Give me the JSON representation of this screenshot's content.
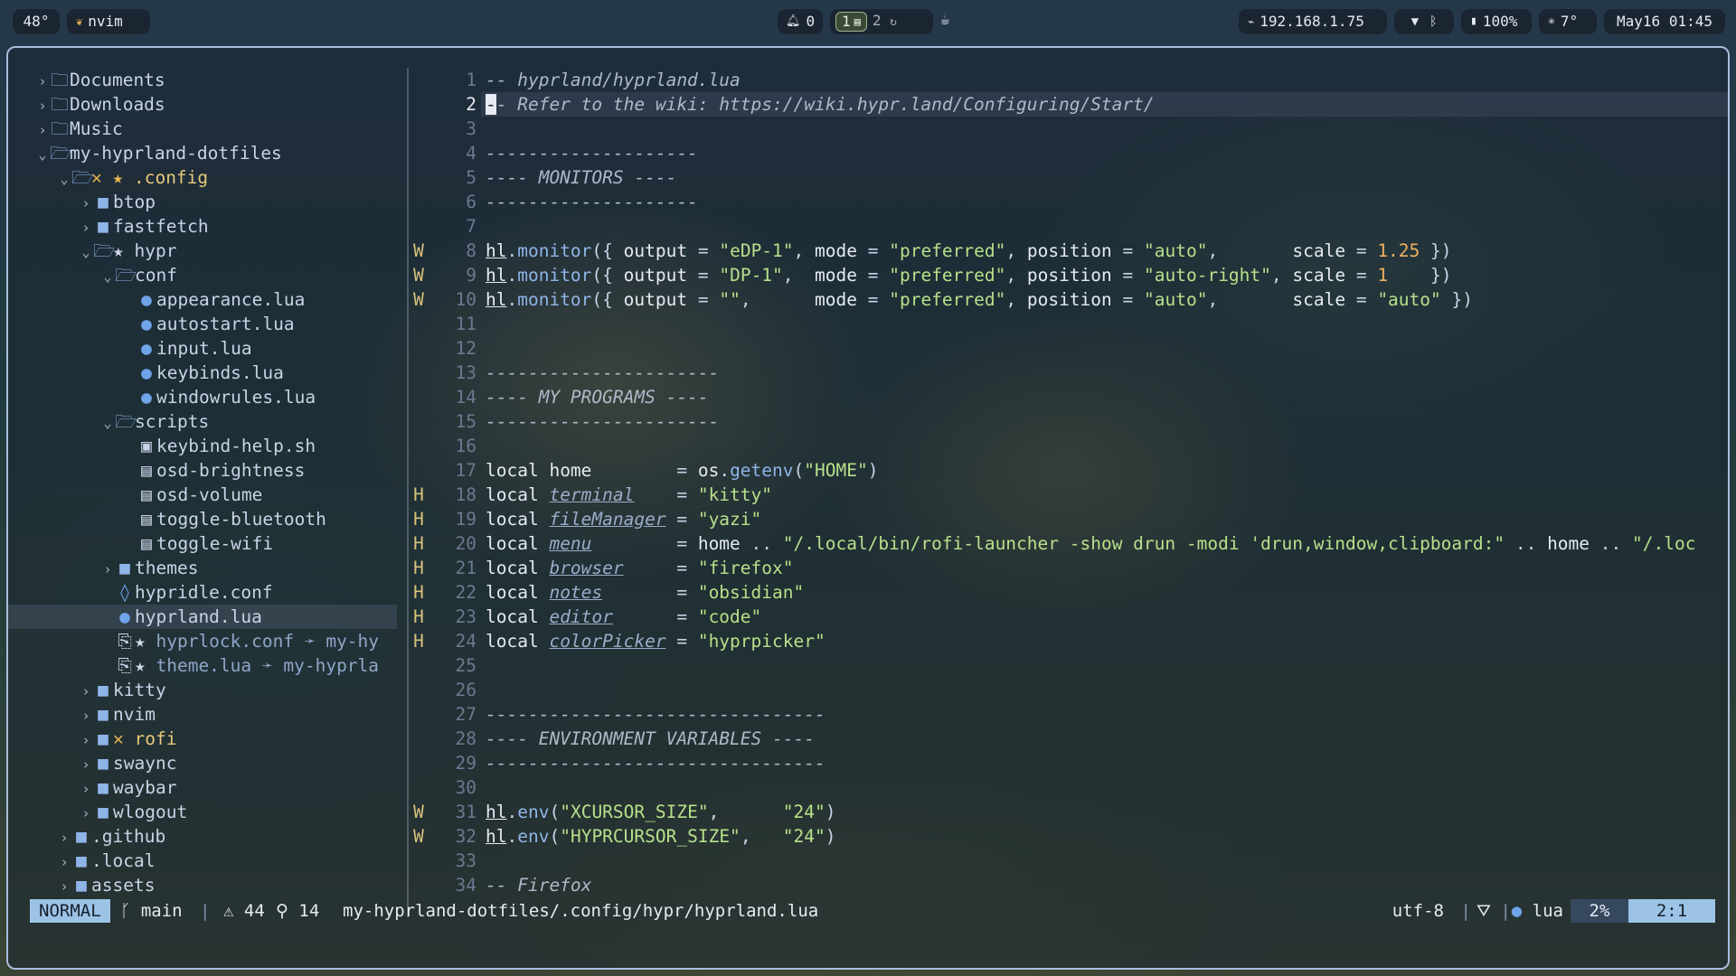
{
  "topbar": {
    "temp_left": "48°",
    "app_name": "nvim",
    "notifications": "0",
    "workspaces": [
      "1",
      "2"
    ],
    "ip": "192.168.1.75",
    "battery": "100%",
    "weather": "7°",
    "datetime": "May16 01:45"
  },
  "tree": [
    {
      "indent": 0,
      "chev": "›",
      "icon": "folder",
      "label": "Documents"
    },
    {
      "indent": 0,
      "chev": "›",
      "icon": "folder",
      "label": "Downloads"
    },
    {
      "indent": 0,
      "chev": "›",
      "icon": "folder",
      "label": "Music"
    },
    {
      "indent": 0,
      "chev": "⌄",
      "icon": "folder-open",
      "label": "my-hyprland-dotfiles"
    },
    {
      "indent": 1,
      "chev": "⌄",
      "icon": "folder-open",
      "marks": "✕ ★",
      "label": ".config",
      "labelClass": "modified"
    },
    {
      "indent": 2,
      "chev": "›",
      "icon": "folder-solid",
      "label": "btop"
    },
    {
      "indent": 2,
      "chev": "›",
      "icon": "folder-solid",
      "label": "fastfetch"
    },
    {
      "indent": 2,
      "chev": "⌄",
      "icon": "folder-open",
      "marks": "★",
      "label": "hypr"
    },
    {
      "indent": 3,
      "chev": "⌄",
      "icon": "folder-open",
      "label": "conf"
    },
    {
      "indent": 4,
      "chev": "",
      "icon": "lua",
      "label": "appearance.lua"
    },
    {
      "indent": 4,
      "chev": "",
      "icon": "lua",
      "label": "autostart.lua"
    },
    {
      "indent": 4,
      "chev": "",
      "icon": "lua",
      "label": "input.lua"
    },
    {
      "indent": 4,
      "chev": "",
      "icon": "lua",
      "label": "keybinds.lua"
    },
    {
      "indent": 4,
      "chev": "",
      "icon": "lua",
      "label": "windowrules.lua"
    },
    {
      "indent": 3,
      "chev": "⌄",
      "icon": "folder-open",
      "label": "scripts"
    },
    {
      "indent": 4,
      "chev": "",
      "icon": "shell",
      "label": "keybind-help.sh"
    },
    {
      "indent": 4,
      "chev": "",
      "icon": "file",
      "label": "osd-brightness"
    },
    {
      "indent": 4,
      "chev": "",
      "icon": "file",
      "label": "osd-volume"
    },
    {
      "indent": 4,
      "chev": "",
      "icon": "file",
      "label": "toggle-bluetooth"
    },
    {
      "indent": 4,
      "chev": "",
      "icon": "file",
      "label": "toggle-wifi"
    },
    {
      "indent": 3,
      "chev": "›",
      "icon": "folder-solid",
      "label": "themes"
    },
    {
      "indent": 3,
      "chev": "",
      "icon": "drop",
      "label": "hypridle.conf"
    },
    {
      "indent": 3,
      "chev": "",
      "icon": "lua",
      "label": "hyprland.lua",
      "selected": true
    },
    {
      "indent": 3,
      "chev": "",
      "icon": "symlink",
      "marks": "★",
      "label": "hyprlock.conf ➛ my-hy",
      "labelClass": "link-t"
    },
    {
      "indent": 3,
      "chev": "",
      "icon": "symlink",
      "marks": "★",
      "label": "theme.lua ➛ my-hyprla",
      "labelClass": "link-t"
    },
    {
      "indent": 2,
      "chev": "›",
      "icon": "folder-solid",
      "label": "kitty"
    },
    {
      "indent": 2,
      "chev": "›",
      "icon": "folder-solid",
      "label": "nvim"
    },
    {
      "indent": 2,
      "chev": "›",
      "icon": "folder-solid",
      "marks": "✕",
      "label": "rofi",
      "labelClass": "modified"
    },
    {
      "indent": 2,
      "chev": "›",
      "icon": "folder-solid",
      "label": "swaync"
    },
    {
      "indent": 2,
      "chev": "›",
      "icon": "folder-solid",
      "label": "waybar"
    },
    {
      "indent": 2,
      "chev": "›",
      "icon": "folder-solid",
      "label": "wlogout"
    },
    {
      "indent": 1,
      "chev": "›",
      "icon": "folder-solid",
      "label": ".github"
    },
    {
      "indent": 1,
      "chev": "›",
      "icon": "folder-solid",
      "label": ".local"
    },
    {
      "indent": 1,
      "chev": "›",
      "icon": "folder-solid",
      "label": "assets"
    }
  ],
  "code": [
    {
      "n": "1",
      "sign": "",
      "tokens": [
        [
          "c-cm",
          "-- hyprland/hyprland.lua"
        ]
      ]
    },
    {
      "n": "2",
      "sign": "",
      "current": true,
      "tokens": [
        [
          "cursor",
          "-"
        ],
        [
          "c-cm",
          "- Refer to the wiki: https://wiki.hypr.land/Configuring/Start/"
        ]
      ]
    },
    {
      "n": "3",
      "sign": "",
      "tokens": []
    },
    {
      "n": "4",
      "sign": "",
      "tokens": [
        [
          "c-cm",
          "--------------------"
        ]
      ]
    },
    {
      "n": "5",
      "sign": "",
      "tokens": [
        [
          "c-cm",
          "---- MONITORS ----"
        ]
      ]
    },
    {
      "n": "6",
      "sign": "",
      "tokens": [
        [
          "c-cm",
          "--------------------"
        ]
      ]
    },
    {
      "n": "7",
      "sign": "",
      "tokens": []
    },
    {
      "n": "8",
      "sign": "W",
      "tokens": [
        [
          "c-ul",
          "hl"
        ],
        [
          "c-p",
          "."
        ],
        [
          "c-fn",
          "monitor"
        ],
        [
          "c-p",
          "({ "
        ],
        [
          "c-id",
          "output"
        ],
        [
          "c-p",
          " = "
        ],
        [
          "c-str",
          "\"eDP-1\""
        ],
        [
          "c-p",
          ", "
        ],
        [
          "c-id",
          "mode"
        ],
        [
          "c-p",
          " = "
        ],
        [
          "c-str",
          "\"preferred\""
        ],
        [
          "c-p",
          ", "
        ],
        [
          "c-id",
          "position"
        ],
        [
          "c-p",
          " = "
        ],
        [
          "c-str",
          "\"auto\""
        ],
        [
          "c-p",
          ",       "
        ],
        [
          "c-id",
          "scale"
        ],
        [
          "c-p",
          " = "
        ],
        [
          "c-num",
          "1.25"
        ],
        [
          "c-p",
          " })"
        ]
      ]
    },
    {
      "n": "9",
      "sign": "W",
      "tokens": [
        [
          "c-ul",
          "hl"
        ],
        [
          "c-p",
          "."
        ],
        [
          "c-fn",
          "monitor"
        ],
        [
          "c-p",
          "({ "
        ],
        [
          "c-id",
          "output"
        ],
        [
          "c-p",
          " = "
        ],
        [
          "c-str",
          "\"DP-1\""
        ],
        [
          "c-p",
          ",  "
        ],
        [
          "c-id",
          "mode"
        ],
        [
          "c-p",
          " = "
        ],
        [
          "c-str",
          "\"preferred\""
        ],
        [
          "c-p",
          ", "
        ],
        [
          "c-id",
          "position"
        ],
        [
          "c-p",
          " = "
        ],
        [
          "c-str",
          "\"auto-right\""
        ],
        [
          "c-p",
          ", "
        ],
        [
          "c-id",
          "scale"
        ],
        [
          "c-p",
          " = "
        ],
        [
          "c-num",
          "1"
        ],
        [
          "c-p",
          "    })"
        ]
      ]
    },
    {
      "n": "10",
      "sign": "W",
      "tokens": [
        [
          "c-ul",
          "hl"
        ],
        [
          "c-p",
          "."
        ],
        [
          "c-fn",
          "monitor"
        ],
        [
          "c-p",
          "({ "
        ],
        [
          "c-id",
          "output"
        ],
        [
          "c-p",
          " = "
        ],
        [
          "c-str",
          "\"\""
        ],
        [
          "c-p",
          ",      "
        ],
        [
          "c-id",
          "mode"
        ],
        [
          "c-p",
          " = "
        ],
        [
          "c-str",
          "\"preferred\""
        ],
        [
          "c-p",
          ", "
        ],
        [
          "c-id",
          "position"
        ],
        [
          "c-p",
          " = "
        ],
        [
          "c-str",
          "\"auto\""
        ],
        [
          "c-p",
          ",       "
        ],
        [
          "c-id",
          "scale"
        ],
        [
          "c-p",
          " = "
        ],
        [
          "c-str",
          "\"auto\""
        ],
        [
          "c-p",
          " })"
        ]
      ]
    },
    {
      "n": "11",
      "sign": "",
      "tokens": []
    },
    {
      "n": "12",
      "sign": "",
      "tokens": []
    },
    {
      "n": "13",
      "sign": "",
      "tokens": [
        [
          "c-cm",
          "----------------------"
        ]
      ]
    },
    {
      "n": "14",
      "sign": "",
      "tokens": [
        [
          "c-cm",
          "---- MY PROGRAMS ----"
        ]
      ]
    },
    {
      "n": "15",
      "sign": "",
      "tokens": [
        [
          "c-cm",
          "----------------------"
        ]
      ]
    },
    {
      "n": "16",
      "sign": "",
      "tokens": []
    },
    {
      "n": "17",
      "sign": "",
      "tokens": [
        [
          "c-kw",
          "local "
        ],
        [
          "c-id",
          "home"
        ],
        [
          "c-p",
          "        = "
        ],
        [
          "c-id",
          "os"
        ],
        [
          "c-p",
          "."
        ],
        [
          "c-fn",
          "getenv"
        ],
        [
          "c-p",
          "("
        ],
        [
          "c-str",
          "\"HOME\""
        ],
        [
          "c-p",
          ")"
        ]
      ]
    },
    {
      "n": "18",
      "sign": "H",
      "tokens": [
        [
          "c-kw",
          "local "
        ],
        [
          "c-ulv",
          "terminal"
        ],
        [
          "c-p",
          "    = "
        ],
        [
          "c-str",
          "\"kitty\""
        ]
      ]
    },
    {
      "n": "19",
      "sign": "H",
      "tokens": [
        [
          "c-kw",
          "local "
        ],
        [
          "c-ulv",
          "fileManager"
        ],
        [
          "c-p",
          " = "
        ],
        [
          "c-str",
          "\"yazi\""
        ]
      ]
    },
    {
      "n": "20",
      "sign": "H",
      "tokens": [
        [
          "c-kw",
          "local "
        ],
        [
          "c-ulv",
          "menu"
        ],
        [
          "c-p",
          "        = "
        ],
        [
          "c-id",
          "home"
        ],
        [
          "c-p",
          " .. "
        ],
        [
          "c-str",
          "\"/.local/bin/rofi-launcher -show drun -modi 'drun,window,clipboard:\""
        ],
        [
          "c-p",
          " .. "
        ],
        [
          "c-id",
          "home"
        ],
        [
          "c-p",
          " .. "
        ],
        [
          "c-str",
          "\"/.loc"
        ]
      ]
    },
    {
      "n": "21",
      "sign": "H",
      "tokens": [
        [
          "c-kw",
          "local "
        ],
        [
          "c-ulv",
          "browser"
        ],
        [
          "c-p",
          "     = "
        ],
        [
          "c-str",
          "\"firefox\""
        ]
      ]
    },
    {
      "n": "22",
      "sign": "H",
      "tokens": [
        [
          "c-kw",
          "local "
        ],
        [
          "c-ulv",
          "notes"
        ],
        [
          "c-p",
          "       = "
        ],
        [
          "c-str",
          "\"obsidian\""
        ]
      ]
    },
    {
      "n": "23",
      "sign": "H",
      "tokens": [
        [
          "c-kw",
          "local "
        ],
        [
          "c-ulv",
          "editor"
        ],
        [
          "c-p",
          "      = "
        ],
        [
          "c-str",
          "\"code\""
        ]
      ]
    },
    {
      "n": "24",
      "sign": "H",
      "tokens": [
        [
          "c-kw",
          "local "
        ],
        [
          "c-ulv",
          "colorPicker"
        ],
        [
          "c-p",
          " = "
        ],
        [
          "c-str",
          "\"hyprpicker\""
        ]
      ]
    },
    {
      "n": "25",
      "sign": "",
      "tokens": []
    },
    {
      "n": "26",
      "sign": "",
      "tokens": []
    },
    {
      "n": "27",
      "sign": "",
      "tokens": [
        [
          "c-cm",
          "--------------------------------"
        ]
      ]
    },
    {
      "n": "28",
      "sign": "",
      "tokens": [
        [
          "c-cm",
          "---- ENVIRONMENT VARIABLES ----"
        ]
      ]
    },
    {
      "n": "29",
      "sign": "",
      "tokens": [
        [
          "c-cm",
          "--------------------------------"
        ]
      ]
    },
    {
      "n": "30",
      "sign": "",
      "tokens": []
    },
    {
      "n": "31",
      "sign": "W",
      "tokens": [
        [
          "c-ul",
          "hl"
        ],
        [
          "c-p",
          "."
        ],
        [
          "c-fn",
          "env"
        ],
        [
          "c-p",
          "("
        ],
        [
          "c-str",
          "\"XCURSOR_SIZE\""
        ],
        [
          "c-p",
          ",      "
        ],
        [
          "c-str",
          "\"24\""
        ],
        [
          "c-p",
          ")"
        ]
      ]
    },
    {
      "n": "32",
      "sign": "W",
      "tokens": [
        [
          "c-ul",
          "hl"
        ],
        [
          "c-p",
          "."
        ],
        [
          "c-fn",
          "env"
        ],
        [
          "c-p",
          "("
        ],
        [
          "c-str",
          "\"HYPRCURSOR_SIZE\""
        ],
        [
          "c-p",
          ",   "
        ],
        [
          "c-str",
          "\"24\""
        ],
        [
          "c-p",
          ")"
        ]
      ]
    },
    {
      "n": "33",
      "sign": "",
      "tokens": []
    },
    {
      "n": "34",
      "sign": "",
      "tokens": [
        [
          "c-cm",
          "-- Firefox"
        ]
      ]
    }
  ],
  "status": {
    "mode": "NORMAL",
    "branch": "main",
    "warnings": "44",
    "hints": "14",
    "filepath": "my-hyprland-dotfiles/.config/hypr/hyprland.lua",
    "encoding": "utf-8",
    "filetype": "lua",
    "percent": "2%",
    "position": "2:1"
  },
  "colors": {
    "accent": "#9cc3e6",
    "folder": "#8fb4e8",
    "string": "#b6e08a",
    "number": "#f0b060",
    "sign": "#d8c27a"
  }
}
